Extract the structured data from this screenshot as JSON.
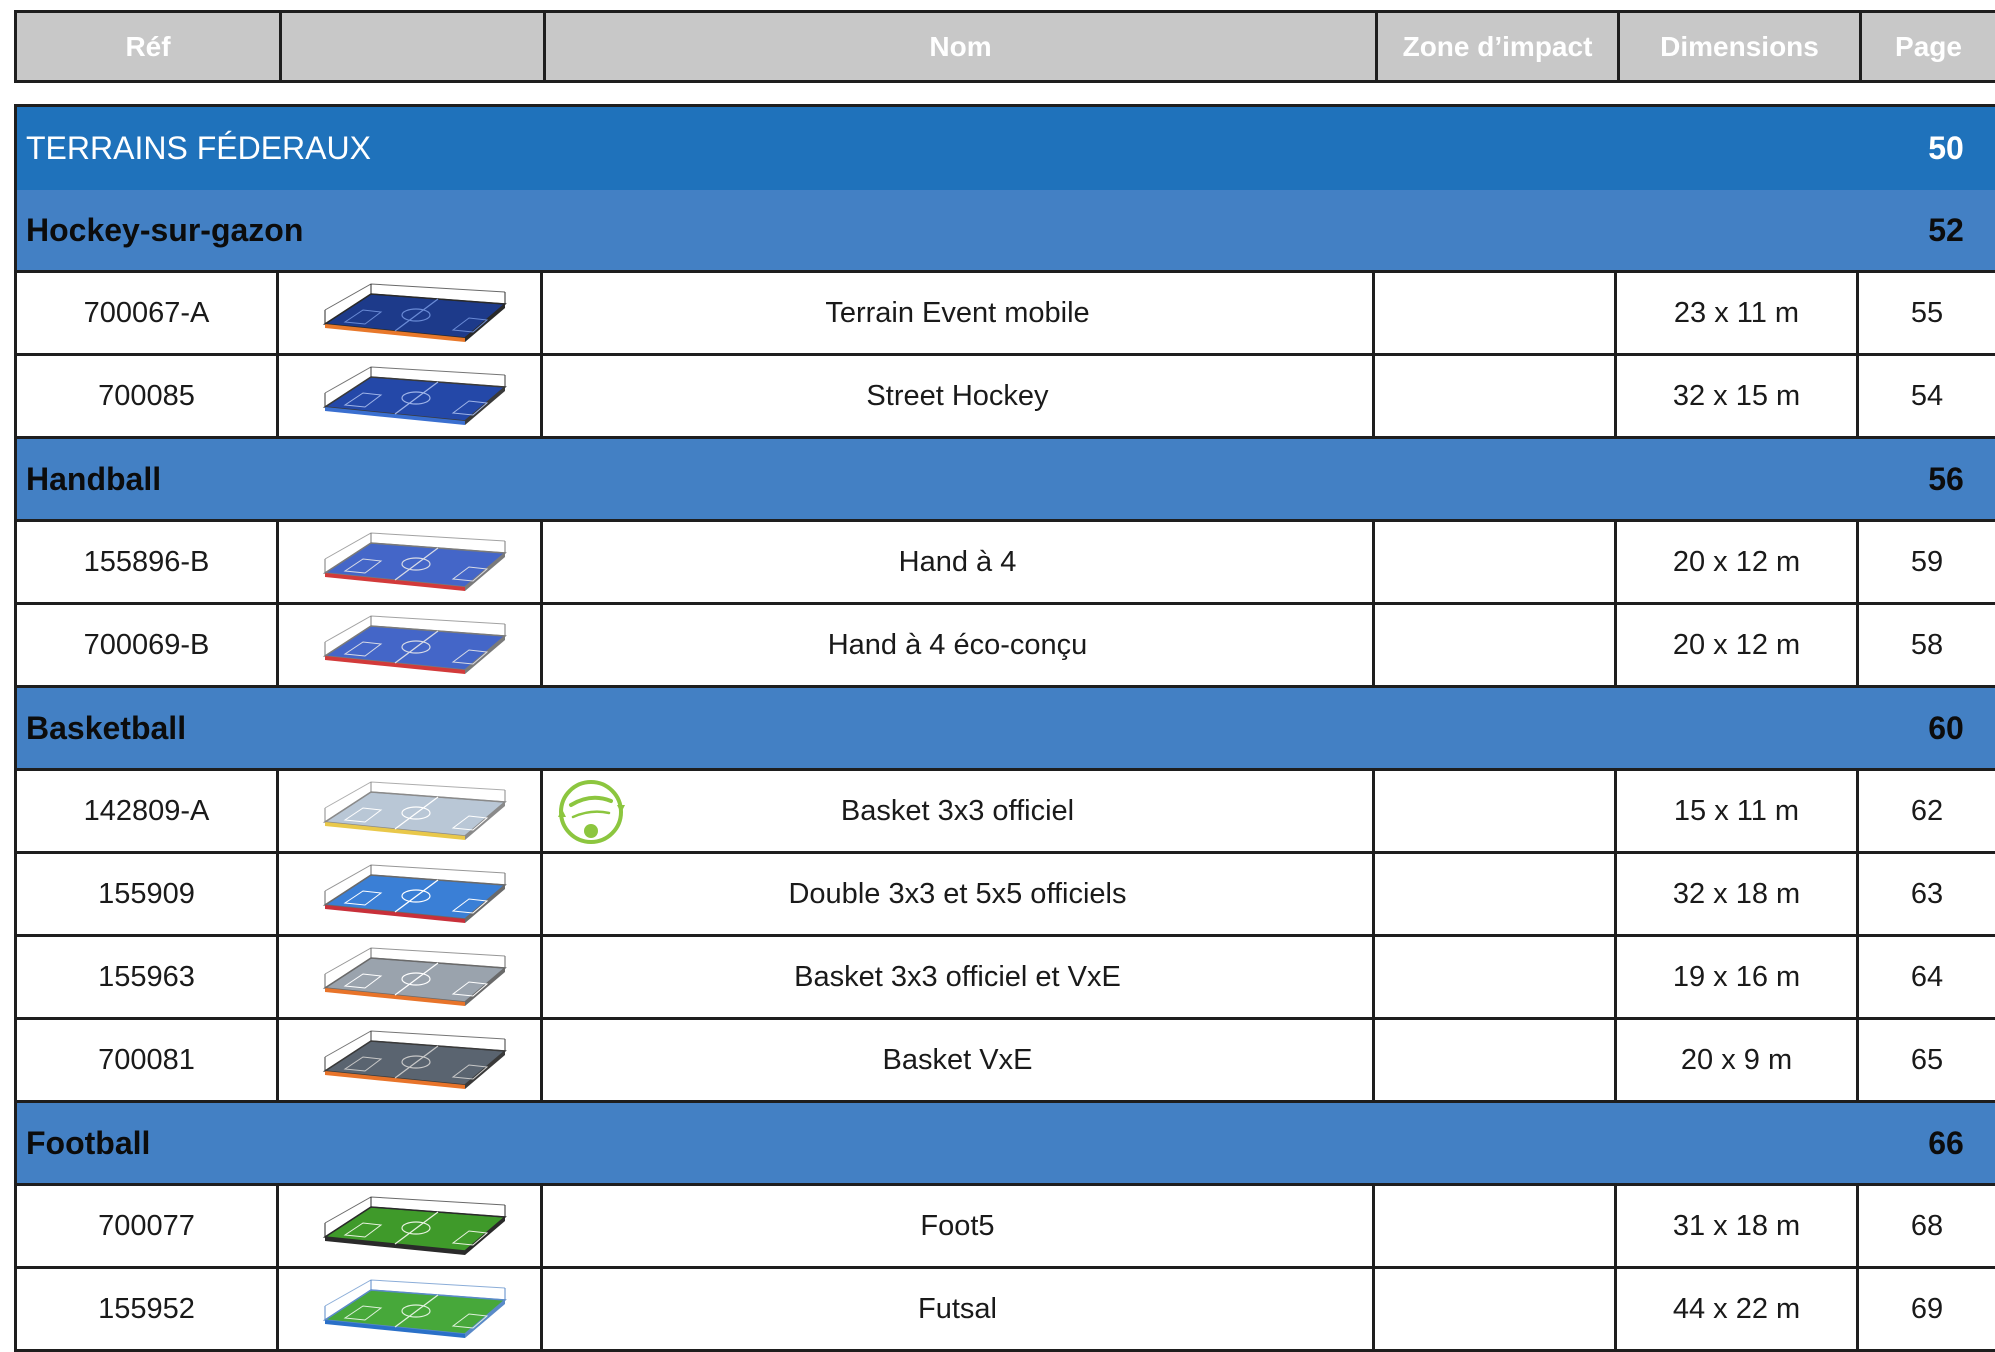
{
  "header": {
    "ref": "Réf",
    "img": "",
    "nom": "Nom",
    "zone": "Zone d’impact",
    "dimensions": "Dimensions",
    "page": "Page"
  },
  "section": {
    "title": "TERRAINS FÉDERAUX",
    "page": "50"
  },
  "categories": [
    {
      "name": "Hockey-sur-gazon",
      "page": "52",
      "rows": [
        {
          "ref": "700067-A",
          "nom": "Terrain Event mobile",
          "zone": "",
          "dim": "23 x 11 m",
          "page": "55",
          "court": "blue-dark"
        },
        {
          "ref": "700085",
          "nom": "Street Hockey",
          "zone": "",
          "dim": "32 x 15 m",
          "page": "54",
          "court": "blue-long"
        }
      ]
    },
    {
      "name": "Handball",
      "page": "56",
      "rows": [
        {
          "ref": "155896-B",
          "nom": "Hand à 4",
          "zone": "",
          "dim": "20 x 12 m",
          "page": "59",
          "court": "red-blue"
        },
        {
          "ref": "700069-B",
          "nom": "Hand à 4 éco-conçu",
          "zone": "",
          "dim": "20 x 12 m",
          "page": "58",
          "court": "red-blue"
        }
      ]
    },
    {
      "name": "Basketball",
      "page": "60",
      "rows": [
        {
          "ref": "142809-A",
          "nom": "Basket 3x3 officiel",
          "zone": "",
          "dim": "15 x 11 m",
          "page": "62",
          "court": "yellow",
          "eco_badge": "eco conçu"
        },
        {
          "ref": "155909",
          "nom": "Double 3x3 et 5x5 officiels",
          "zone": "",
          "dim": "32 x 18 m",
          "page": "63",
          "court": "blue-red"
        },
        {
          "ref": "155963",
          "nom": "Basket 3x3 officiel et VxE",
          "zone": "",
          "dim": "19 x 16 m",
          "page": "64",
          "court": "orange"
        },
        {
          "ref": "700081",
          "nom": "Basket VxE",
          "zone": "",
          "dim": "20 x 9 m",
          "page": "65",
          "court": "grey"
        }
      ]
    },
    {
      "name": "Football",
      "page": "66",
      "rows": [
        {
          "ref": "700077",
          "nom": "Foot5",
          "zone": "",
          "dim": "31 x 18 m",
          "page": "68",
          "court": "green"
        },
        {
          "ref": "155952",
          "nom": "Futsal",
          "zone": "",
          "dim": "44 x 22 m",
          "page": "69",
          "court": "green-light"
        }
      ]
    }
  ],
  "colors": {
    "section": "#1f72bb",
    "category": "#4380c4",
    "header": "#c8c8c8",
    "eco": "#8cc63f"
  }
}
